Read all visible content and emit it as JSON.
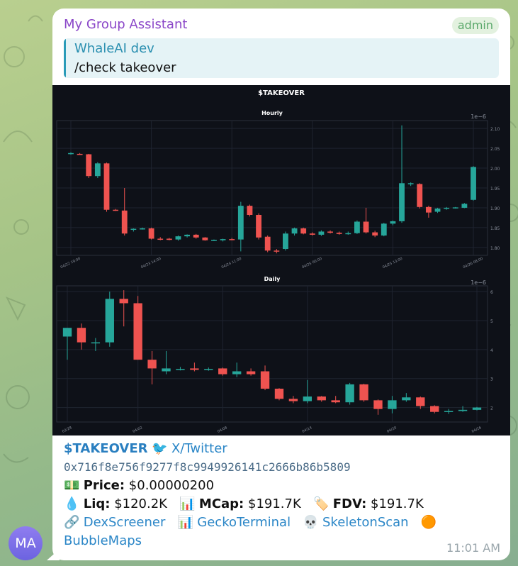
{
  "chat": {
    "sender": "My Group Assistant",
    "role_badge": "admin",
    "avatar_initials": "MA",
    "reply": {
      "author": "WhaleAI dev",
      "text": "/check takeover"
    },
    "timestamp": "11:01 AM"
  },
  "message": {
    "ticker": "$TAKEOVER",
    "twitter_label": "X/Twitter",
    "contract": "0x716f8e756f9277f8c9949926141c2666b86b5809",
    "price_label": "Price:",
    "price_value": "$0.00000200",
    "liq_label": "Liq:",
    "liq_value": "$120.2K",
    "mcap_label": "MCap:",
    "mcap_value": "$191.7K",
    "fdv_label": "FDV:",
    "fdv_value": "$191.7K",
    "links": [
      "DexScreener",
      "GeckoTerminal",
      "SkeletonScan",
      "BubbleMaps"
    ],
    "icons": {
      "twitter": "bird-icon",
      "price": "money-icon",
      "liq": "droplet-icon",
      "mcap": "bar-chart-icon",
      "fdv": "tag-icon",
      "dexscreener": "link-icon",
      "geckoterminal": "bar-chart-icon",
      "skeletonscan": "skull-icon",
      "bubblemaps": "orange-circle-icon"
    }
  },
  "colors": {
    "up": "#26a69a",
    "down": "#ef5350",
    "chart_bg": "#0e1118",
    "link": "#2a86c7",
    "sender": "#8a46c8"
  },
  "chart_data": [
    {
      "type": "candlestick",
      "figure_title": "$TAKEOVER",
      "title": "Hourly",
      "y_scale_note": "1e−6",
      "ylim": [
        1.78,
        2.12
      ],
      "y_ticks": [
        "1.80",
        "1.85",
        "1.90",
        "1.95",
        "2.00",
        "2.05",
        "2.10"
      ],
      "x_ticks": [
        "04/22 19:00",
        "04/23 14:00",
        "04/24 11:00",
        "04/25 00:00",
        "04/25 13:00",
        "04/26 08:00"
      ],
      "x_tick_index": [
        0,
        9,
        18,
        27,
        36,
        45
      ],
      "candles": [
        {
          "o": 2.036,
          "h": 2.04,
          "l": 2.034,
          "c": 2.038
        },
        {
          "o": 2.036,
          "h": 2.038,
          "l": 2.034,
          "c": 2.035
        },
        {
          "o": 2.035,
          "h": 2.036,
          "l": 1.975,
          "c": 1.98
        },
        {
          "o": 1.98,
          "h": 2.015,
          "l": 1.975,
          "c": 2.012
        },
        {
          "o": 2.012,
          "h": 2.014,
          "l": 1.89,
          "c": 1.895
        },
        {
          "o": 1.895,
          "h": 1.897,
          "l": 1.892,
          "c": 1.893
        },
        {
          "o": 1.893,
          "h": 1.95,
          "l": 1.83,
          "c": 1.835
        },
        {
          "o": 1.845,
          "h": 1.848,
          "l": 1.84,
          "c": 1.847
        },
        {
          "o": 1.847,
          "h": 1.85,
          "l": 1.845,
          "c": 1.848
        },
        {
          "o": 1.848,
          "h": 1.85,
          "l": 1.82,
          "c": 1.822
        },
        {
          "o": 1.822,
          "h": 1.826,
          "l": 1.818,
          "c": 1.82
        },
        {
          "o": 1.822,
          "h": 1.824,
          "l": 1.818,
          "c": 1.819
        },
        {
          "o": 1.82,
          "h": 1.83,
          "l": 1.817,
          "c": 1.828
        },
        {
          "o": 1.828,
          "h": 1.833,
          "l": 1.825,
          "c": 1.832
        },
        {
          "o": 1.832,
          "h": 1.834,
          "l": 1.822,
          "c": 1.825
        },
        {
          "o": 1.825,
          "h": 1.826,
          "l": 1.817,
          "c": 1.818
        },
        {
          "o": 1.818,
          "h": 1.82,
          "l": 1.816,
          "c": 1.819
        },
        {
          "o": 1.818,
          "h": 1.822,
          "l": 1.815,
          "c": 1.821
        },
        {
          "o": 1.821,
          "h": 1.824,
          "l": 1.818,
          "c": 1.819
        },
        {
          "o": 1.82,
          "h": 1.915,
          "l": 1.79,
          "c": 1.905
        },
        {
          "o": 1.905,
          "h": 1.908,
          "l": 1.878,
          "c": 1.882
        },
        {
          "o": 1.882,
          "h": 1.886,
          "l": 1.82,
          "c": 1.825
        },
        {
          "o": 1.827,
          "h": 1.83,
          "l": 1.788,
          "c": 1.792
        },
        {
          "o": 1.792,
          "h": 1.796,
          "l": 1.785,
          "c": 1.79
        },
        {
          "o": 1.796,
          "h": 1.84,
          "l": 1.792,
          "c": 1.835
        },
        {
          "o": 1.835,
          "h": 1.85,
          "l": 1.83,
          "c": 1.848
        },
        {
          "o": 1.848,
          "h": 1.85,
          "l": 1.833,
          "c": 1.835
        },
        {
          "o": 1.835,
          "h": 1.838,
          "l": 1.83,
          "c": 1.832
        },
        {
          "o": 1.832,
          "h": 1.843,
          "l": 1.829,
          "c": 1.84
        },
        {
          "o": 1.84,
          "h": 1.843,
          "l": 1.835,
          "c": 1.837
        },
        {
          "o": 1.837,
          "h": 1.84,
          "l": 1.832,
          "c": 1.834
        },
        {
          "o": 1.834,
          "h": 1.84,
          "l": 1.832,
          "c": 1.836
        },
        {
          "o": 1.836,
          "h": 1.868,
          "l": 1.834,
          "c": 1.865
        },
        {
          "o": 1.865,
          "h": 1.9,
          "l": 1.835,
          "c": 1.838
        },
        {
          "o": 1.838,
          "h": 1.842,
          "l": 1.826,
          "c": 1.83
        },
        {
          "o": 1.83,
          "h": 1.862,
          "l": 1.828,
          "c": 1.86
        },
        {
          "o": 1.86,
          "h": 1.868,
          "l": 1.856,
          "c": 1.866
        },
        {
          "o": 1.866,
          "h": 2.108,
          "l": 1.862,
          "c": 1.962
        },
        {
          "o": 1.96,
          "h": 1.964,
          "l": 1.955,
          "c": 1.962
        },
        {
          "o": 1.96,
          "h": 1.962,
          "l": 1.898,
          "c": 1.902
        },
        {
          "o": 1.902,
          "h": 1.905,
          "l": 1.875,
          "c": 1.888
        },
        {
          "o": 1.89,
          "h": 1.9,
          "l": 1.887,
          "c": 1.898
        },
        {
          "o": 1.898,
          "h": 1.902,
          "l": 1.895,
          "c": 1.9
        },
        {
          "o": 1.9,
          "h": 1.902,
          "l": 1.898,
          "c": 1.901
        },
        {
          "o": 1.9,
          "h": 1.912,
          "l": 1.899,
          "c": 1.91
        },
        {
          "o": 1.92,
          "h": 2.005,
          "l": 1.918,
          "c": 2.003
        }
      ]
    },
    {
      "type": "candlestick",
      "title": "Daily",
      "y_scale_note": "1e−6",
      "ylim": [
        1.5,
        6.2
      ],
      "y_ticks": [
        "2",
        "3",
        "4",
        "5",
        "6"
      ],
      "x_ticks": [
        "03/28",
        "04/02",
        "04/08",
        "04/14",
        "04/20",
        "04/26"
      ],
      "x_tick_index": [
        0,
        5,
        11,
        17,
        23,
        29
      ],
      "candles": [
        {
          "o": 4.45,
          "h": 4.75,
          "l": 3.65,
          "c": 4.75
        },
        {
          "o": 4.75,
          "h": 4.9,
          "l": 4.0,
          "c": 4.25
        },
        {
          "o": 4.25,
          "h": 4.4,
          "l": 3.95,
          "c": 4.25
        },
        {
          "o": 4.25,
          "h": 6.0,
          "l": 4.1,
          "c": 5.75
        },
        {
          "o": 5.75,
          "h": 6.05,
          "l": 4.8,
          "c": 5.6
        },
        {
          "o": 5.6,
          "h": 5.85,
          "l": 3.65,
          "c": 3.65
        },
        {
          "o": 3.65,
          "h": 3.95,
          "l": 2.8,
          "c": 3.35
        },
        {
          "o": 3.25,
          "h": 3.95,
          "l": 3.15,
          "c": 3.35
        },
        {
          "o": 3.33,
          "h": 3.4,
          "l": 3.28,
          "c": 3.33
        },
        {
          "o": 3.35,
          "h": 3.55,
          "l": 3.25,
          "c": 3.3
        },
        {
          "o": 3.33,
          "h": 3.38,
          "l": 3.27,
          "c": 3.33
        },
        {
          "o": 3.35,
          "h": 3.38,
          "l": 3.1,
          "c": 3.15
        },
        {
          "o": 3.15,
          "h": 3.55,
          "l": 3.05,
          "c": 3.25
        },
        {
          "o": 3.25,
          "h": 3.35,
          "l": 3.1,
          "c": 3.15
        },
        {
          "o": 3.25,
          "h": 3.45,
          "l": 2.6,
          "c": 2.65
        },
        {
          "o": 2.65,
          "h": 2.67,
          "l": 2.25,
          "c": 2.3
        },
        {
          "o": 2.3,
          "h": 2.4,
          "l": 2.15,
          "c": 2.22
        },
        {
          "o": 2.22,
          "h": 2.95,
          "l": 2.15,
          "c": 2.38
        },
        {
          "o": 2.38,
          "h": 2.4,
          "l": 2.2,
          "c": 2.25
        },
        {
          "o": 2.25,
          "h": 2.4,
          "l": 2.15,
          "c": 2.18
        },
        {
          "o": 2.18,
          "h": 2.85,
          "l": 2.1,
          "c": 2.8
        },
        {
          "o": 2.8,
          "h": 2.82,
          "l": 2.2,
          "c": 2.25
        },
        {
          "o": 2.25,
          "h": 2.28,
          "l": 1.75,
          "c": 1.95
        },
        {
          "o": 1.95,
          "h": 2.4,
          "l": 1.8,
          "c": 2.25
        },
        {
          "o": 2.25,
          "h": 2.5,
          "l": 2.2,
          "c": 2.35
        },
        {
          "o": 2.35,
          "h": 2.38,
          "l": 1.95,
          "c": 2.05
        },
        {
          "o": 2.05,
          "h": 2.08,
          "l": 1.8,
          "c": 1.85
        },
        {
          "o": 1.85,
          "h": 1.95,
          "l": 1.78,
          "c": 1.88
        },
        {
          "o": 1.88,
          "h": 2.05,
          "l": 1.85,
          "c": 1.92
        },
        {
          "o": 1.92,
          "h": 2.02,
          "l": 1.9,
          "c": 2.0
        }
      ]
    }
  ]
}
